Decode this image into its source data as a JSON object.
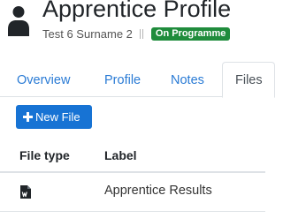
{
  "header": {
    "title": "Apprentice Profile",
    "subtitle_name": "Test 6 Surname 2",
    "status_badge": "On Programme",
    "status_badge_color": "#1f8c3c",
    "icon": "person-icon"
  },
  "tabs": [
    {
      "label": "Overview",
      "active": false
    },
    {
      "label": "Profile",
      "active": false
    },
    {
      "label": "Notes",
      "active": false
    },
    {
      "label": "Files",
      "active": true
    }
  ],
  "toolbar": {
    "new_file_label": "New File",
    "new_file_icon": "plus-icon",
    "accent_color": "#1773d4"
  },
  "files_table": {
    "columns": [
      "File type",
      "Label"
    ],
    "rows": [
      {
        "file_type_icon": "word-document-icon",
        "label": "Apprentice Results"
      }
    ]
  }
}
